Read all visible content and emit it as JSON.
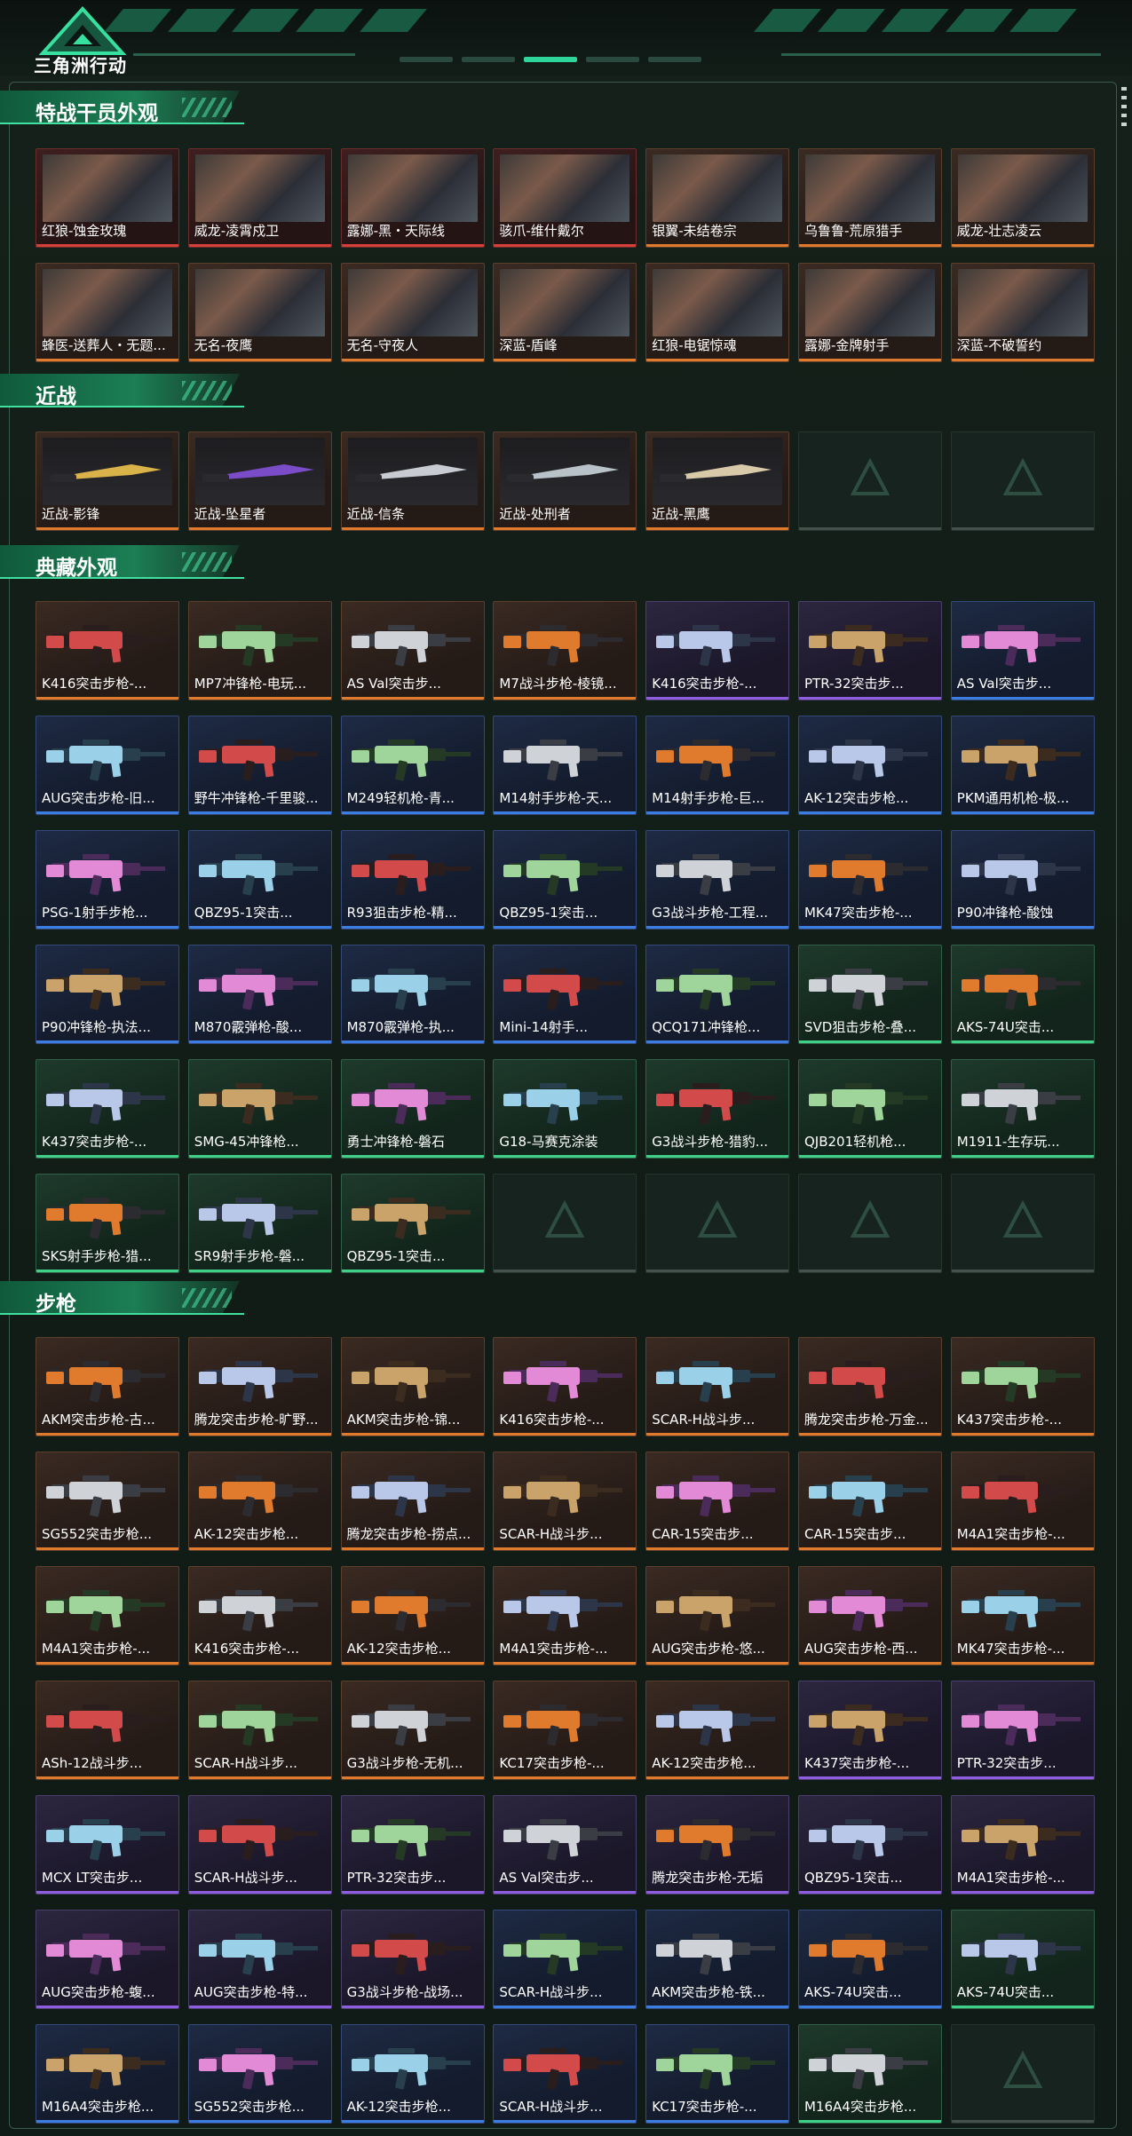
{
  "header": {
    "game_title": "三角洲行动"
  },
  "sections": [
    {
      "title": "特战干员外观",
      "kind": "operator",
      "items": [
        {
          "label": "红狼-蚀金玫瑰",
          "rarity": "red"
        },
        {
          "label": "威龙-凌霄戍卫",
          "rarity": "red"
        },
        {
          "label": "露娜-黑・天际线",
          "rarity": "red"
        },
        {
          "label": "骇爪-维什戴尔",
          "rarity": "red"
        },
        {
          "label": "银翼-未结卷宗",
          "rarity": "orange"
        },
        {
          "label": "乌鲁鲁-荒原猎手",
          "rarity": "orange"
        },
        {
          "label": "威龙-壮志凌云",
          "rarity": "orange"
        },
        {
          "label": "蜂医-送葬人・无题...",
          "rarity": "orange"
        },
        {
          "label": "无名-夜鹰",
          "rarity": "orange"
        },
        {
          "label": "无名-守夜人",
          "rarity": "orange"
        },
        {
          "label": "深蓝-盾峰",
          "rarity": "orange"
        },
        {
          "label": "红狼-电锯惊魂",
          "rarity": "orange"
        },
        {
          "label": "露娜-金牌射手",
          "rarity": "orange"
        },
        {
          "label": "深蓝-不破誓约",
          "rarity": "orange"
        }
      ]
    },
    {
      "title": "近战",
      "kind": "knife",
      "items": [
        {
          "label": "近战-影锋",
          "rarity": "orange"
        },
        {
          "label": "近战-坠星者",
          "rarity": "orange"
        },
        {
          "label": "近战-信条",
          "rarity": "orange"
        },
        {
          "label": "近战-处刑者",
          "rarity": "orange"
        },
        {
          "label": "近战-黑鹰",
          "rarity": "orange"
        },
        {
          "label": "",
          "rarity": "empty"
        },
        {
          "label": "",
          "rarity": "empty"
        }
      ]
    },
    {
      "title": "典藏外观",
      "kind": "gun",
      "items": [
        {
          "label": "K416突击步枪-...",
          "rarity": "orange"
        },
        {
          "label": "MP7冲锋枪-电玩...",
          "rarity": "orange"
        },
        {
          "label": "AS Val突击步...",
          "rarity": "orange"
        },
        {
          "label": "M7战斗步枪-棱镜...",
          "rarity": "orange"
        },
        {
          "label": "K416突击步枪-...",
          "rarity": "purple"
        },
        {
          "label": "PTR-32突击步...",
          "rarity": "purple"
        },
        {
          "label": "AS Val突击步...",
          "rarity": "blue"
        },
        {
          "label": "AUG突击步枪-旧...",
          "rarity": "blue"
        },
        {
          "label": "野牛冲锋枪-千里骏...",
          "rarity": "blue"
        },
        {
          "label": "M249轻机枪-青...",
          "rarity": "blue"
        },
        {
          "label": "M14射手步枪-天...",
          "rarity": "blue"
        },
        {
          "label": "M14射手步枪-巨...",
          "rarity": "blue"
        },
        {
          "label": "AK-12突击步枪...",
          "rarity": "blue"
        },
        {
          "label": "PKM通用机枪-极...",
          "rarity": "blue"
        },
        {
          "label": "PSG-1射手步枪...",
          "rarity": "blue"
        },
        {
          "label": "QBZ95-1突击...",
          "rarity": "blue"
        },
        {
          "label": "R93狙击步枪-精...",
          "rarity": "blue"
        },
        {
          "label": "QBZ95-1突击...",
          "rarity": "blue"
        },
        {
          "label": "G3战斗步枪-工程...",
          "rarity": "blue"
        },
        {
          "label": "MK47突击步枪-...",
          "rarity": "blue"
        },
        {
          "label": "P90冲锋枪-酸蚀",
          "rarity": "blue"
        },
        {
          "label": "P90冲锋枪-执法...",
          "rarity": "blue"
        },
        {
          "label": "M870霰弹枪-酸...",
          "rarity": "blue"
        },
        {
          "label": "M870霰弹枪-执...",
          "rarity": "blue"
        },
        {
          "label": "Mini-14射手...",
          "rarity": "blue"
        },
        {
          "label": "QCQ171冲锋枪...",
          "rarity": "blue"
        },
        {
          "label": "SVD狙击步枪-叠...",
          "rarity": "green"
        },
        {
          "label": "AKS-74U突击...",
          "rarity": "green"
        },
        {
          "label": "K437突击步枪-...",
          "rarity": "green"
        },
        {
          "label": "SMG-45冲锋枪...",
          "rarity": "green"
        },
        {
          "label": "勇士冲锋枪-磐石",
          "rarity": "green"
        },
        {
          "label": "G18-马赛克涂装",
          "rarity": "green"
        },
        {
          "label": "G3战斗步枪-猎豹...",
          "rarity": "green"
        },
        {
          "label": "QJB201轻机枪...",
          "rarity": "green"
        },
        {
          "label": "M1911-生存玩...",
          "rarity": "green"
        },
        {
          "label": "SKS射手步枪-猎...",
          "rarity": "green"
        },
        {
          "label": "SR9射手步枪-磐...",
          "rarity": "green"
        },
        {
          "label": "QBZ95-1突击...",
          "rarity": "green"
        },
        {
          "label": "",
          "rarity": "empty"
        },
        {
          "label": "",
          "rarity": "empty"
        },
        {
          "label": "",
          "rarity": "empty"
        },
        {
          "label": "",
          "rarity": "empty"
        }
      ]
    },
    {
      "title": "步枪",
      "kind": "gun",
      "items": [
        {
          "label": "AKM突击步枪-古...",
          "rarity": "orange"
        },
        {
          "label": "腾龙突击步枪-旷野...",
          "rarity": "orange"
        },
        {
          "label": "AKM突击步枪-锦...",
          "rarity": "orange"
        },
        {
          "label": "K416突击步枪-...",
          "rarity": "orange"
        },
        {
          "label": "SCAR-H战斗步...",
          "rarity": "orange"
        },
        {
          "label": "腾龙突击步枪-万金...",
          "rarity": "orange"
        },
        {
          "label": "K437突击步枪-...",
          "rarity": "orange"
        },
        {
          "label": "SG552突击步枪...",
          "rarity": "orange"
        },
        {
          "label": "AK-12突击步枪...",
          "rarity": "orange"
        },
        {
          "label": "腾龙突击步枪-捞点...",
          "rarity": "orange"
        },
        {
          "label": "SCAR-H战斗步...",
          "rarity": "orange"
        },
        {
          "label": "CAR-15突击步...",
          "rarity": "orange"
        },
        {
          "label": "CAR-15突击步...",
          "rarity": "orange"
        },
        {
          "label": "M4A1突击步枪-...",
          "rarity": "orange"
        },
        {
          "label": "M4A1突击步枪-...",
          "rarity": "orange"
        },
        {
          "label": "K416突击步枪-...",
          "rarity": "orange"
        },
        {
          "label": "AK-12突击步枪...",
          "rarity": "orange"
        },
        {
          "label": "M4A1突击步枪-...",
          "rarity": "orange"
        },
        {
          "label": "AUG突击步枪-悠...",
          "rarity": "orange"
        },
        {
          "label": "AUG突击步枪-西...",
          "rarity": "orange"
        },
        {
          "label": "MK47突击步枪-...",
          "rarity": "orange"
        },
        {
          "label": "ASh-12战斗步...",
          "rarity": "orange"
        },
        {
          "label": "SCAR-H战斗步...",
          "rarity": "orange"
        },
        {
          "label": "G3战斗步枪-无机...",
          "rarity": "orange"
        },
        {
          "label": "KC17突击步枪-...",
          "rarity": "orange"
        },
        {
          "label": "AK-12突击步枪...",
          "rarity": "orange"
        },
        {
          "label": "K437突击步枪-...",
          "rarity": "purple"
        },
        {
          "label": "PTR-32突击步...",
          "rarity": "purple"
        },
        {
          "label": "MCX LT突击步...",
          "rarity": "purple"
        },
        {
          "label": "SCAR-H战斗步...",
          "rarity": "purple"
        },
        {
          "label": "PTR-32突击步...",
          "rarity": "purple"
        },
        {
          "label": "AS Val突击步...",
          "rarity": "purple"
        },
        {
          "label": "腾龙突击步枪-无垢",
          "rarity": "purple"
        },
        {
          "label": "QBZ95-1突击...",
          "rarity": "purple"
        },
        {
          "label": "M4A1突击步枪-...",
          "rarity": "purple"
        },
        {
          "label": "AUG突击步枪-蝮...",
          "rarity": "purple"
        },
        {
          "label": "AUG突击步枪-特...",
          "rarity": "purple"
        },
        {
          "label": "G3战斗步枪-战场...",
          "rarity": "purple"
        },
        {
          "label": "SCAR-H战斗步...",
          "rarity": "blue"
        },
        {
          "label": "AKM突击步枪-铁...",
          "rarity": "blue"
        },
        {
          "label": "AKS-74U突击...",
          "rarity": "blue"
        },
        {
          "label": "AKS-74U突击...",
          "rarity": "green"
        },
        {
          "label": "M16A4突击步枪...",
          "rarity": "blue"
        },
        {
          "label": "SG552突击步枪...",
          "rarity": "blue"
        },
        {
          "label": "AK-12突击步枪...",
          "rarity": "blue"
        },
        {
          "label": "SCAR-H战斗步...",
          "rarity": "blue"
        },
        {
          "label": "KC17突击步枪-...",
          "rarity": "blue"
        },
        {
          "label": "M16A4突击步枪...",
          "rarity": "green"
        },
        {
          "label": "",
          "rarity": "empty"
        }
      ]
    }
  ],
  "colors": {
    "accent": "#2fd69b",
    "orange": "#e07a2d",
    "red": "#d6403a",
    "purple": "#8f5ee0",
    "blue": "#3b7de0",
    "green": "#3fcf86"
  },
  "icons": {
    "logo": "delta-triangle-logo",
    "empty_slot": "delta-watermark-icon"
  }
}
